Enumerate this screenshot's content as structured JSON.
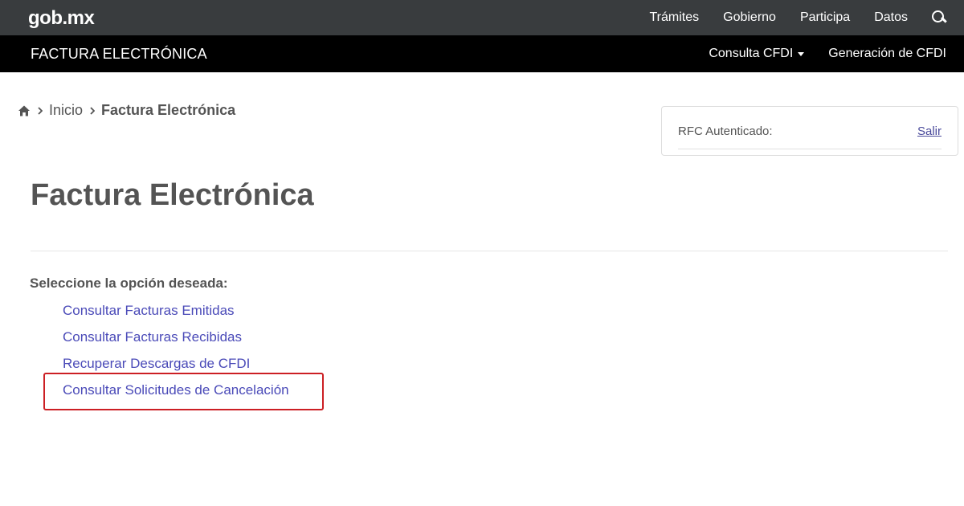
{
  "topbar": {
    "logo_left": "gob",
    "logo_dot": ".",
    "logo_right": "mx",
    "nav": [
      "Trámites",
      "Gobierno",
      "Participa",
      "Datos"
    ],
    "search_icon": "search-icon"
  },
  "subbar": {
    "title": "FACTURA ELECTRÓNICA",
    "consulta_label": "Consulta CFDI",
    "generacion_label": "Generación de CFDI"
  },
  "breadcrumb": {
    "home_icon": "home-icon",
    "inicio": "Inicio",
    "current": "Factura Electrónica"
  },
  "rfc_panel": {
    "label": "RFC Autenticado:",
    "logout": "Salir"
  },
  "main": {
    "title": "Factura Electrónica",
    "prompt": "Seleccione la opción deseada:",
    "options": [
      "Consultar Facturas Emitidas",
      "Consultar Facturas Recibidas",
      "Recuperar Descargas de CFDI",
      "Consultar Solicitudes de Cancelación"
    ]
  },
  "colors": {
    "topbar_bg": "#393c3e",
    "subbar_bg": "#000000",
    "link": "#4a4ab8",
    "highlight": "#cc1f24"
  }
}
